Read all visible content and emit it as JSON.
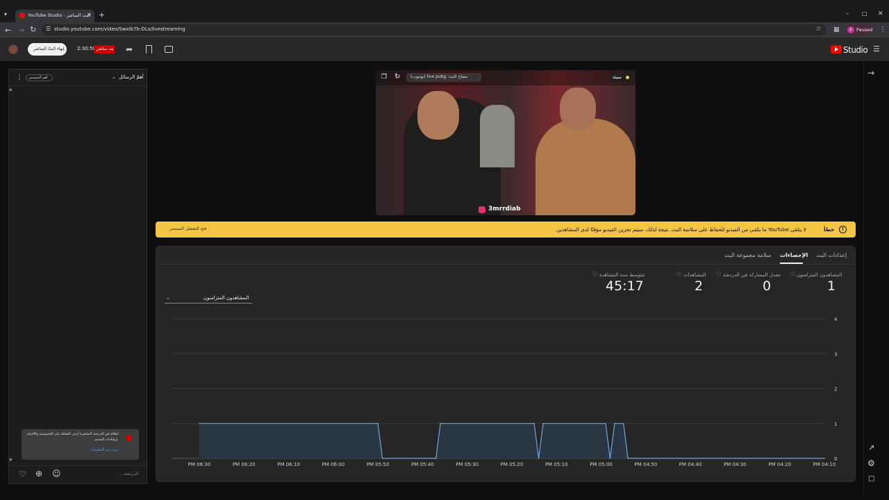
{
  "browser": {
    "tab_title": "YouTube Studio - البث المباشر",
    "url": "studio.youtube.com/video/Swxib7b-DLs/livestreaming",
    "profile_label": "Paused",
    "profile_initial": "s"
  },
  "header": {
    "logo_label": "Studio",
    "end_stream_label": "إنهاء البثّ المباشر",
    "timer": "2:30:58",
    "live_badge": "بث مباشر"
  },
  "chat": {
    "mode_label": "أهمّ الرسائل",
    "members_label": "أهم المنسيين",
    "notice_text_1": "اطلالة في الدردشة المباشرة أرجى الحفاظ على الخصوصية والالتزام",
    "notice_text_2": "بإرشادات المنتدى",
    "notice_link": "مزيد من المعلومات",
    "input_placeholder": "الدردشة..."
  },
  "video": {
    "status_label": "سيئة",
    "stream_key_label": "مفتاح البث:  live pubg (يوتيوب)",
    "watermark": "3mrrdiab"
  },
  "banner": {
    "error_prefix": "خطأ",
    "message": "لا يتلقى YouTube ما يكفي من الفيديو للحفاظ على سلاسة البث. نتيجة لذلك، سيتم تخزين الفيديو مؤقتًا لدى المشاهدين.",
    "action_label": "فتح التشغيل المستمر"
  },
  "analytics": {
    "tabs": [
      "إعدادات البث",
      "الإحصاءات",
      "سلامة مجموعة البث"
    ],
    "active_tab": "الإحصاءات",
    "metrics": [
      {
        "label": "المشاهدون المتزامنون",
        "value": "1"
      },
      {
        "label": "معدل المشاركة في الدردشة",
        "value": "0"
      },
      {
        "label": "المشاهدات",
        "value": "2"
      },
      {
        "label": "متوسط مدة المشاهدة",
        "value": "45:17"
      }
    ],
    "chart_selector": "المشاهدون المتزامنون"
  },
  "colors": {
    "accent": "#3ea6ff",
    "banner": "#f4c542",
    "live_red": "#cc0000",
    "area_fill": "#2a3644",
    "line": "#6fa8dc"
  },
  "chart_data": {
    "type": "area",
    "title": "",
    "xlabel": "",
    "ylabel": "",
    "ylim": [
      0,
      4
    ],
    "yticks": [
      "0",
      "1",
      "2",
      "3",
      "4"
    ],
    "x_ticks": [
      "PM 06:30",
      "PM 06:20",
      "PM 06:10",
      "PM 06:00",
      "PM 05:50",
      "PM 05:40",
      "PM 05:30",
      "PM 05:20",
      "PM 05:10",
      "PM 05:00",
      "PM 04:50",
      "PM 04:40",
      "PM 04:30",
      "PM 04:20",
      "PM 04:10"
    ],
    "x_note": "time runs right-to-left (RTL layout)",
    "series": [
      {
        "name": "المشاهدون المتزامنون",
        "points": [
          [
            "PM 06:30",
            1
          ],
          [
            "PM 05:50",
            1
          ],
          [
            "PM 05:49",
            0
          ],
          [
            "PM 05:37",
            0
          ],
          [
            "PM 05:36",
            1
          ],
          [
            "PM 05:15",
            1
          ],
          [
            "PM 05:14",
            0
          ],
          [
            "PM 05:13",
            1
          ],
          [
            "PM 04:59",
            1
          ],
          [
            "PM 04:58",
            0
          ],
          [
            "PM 04:57",
            1
          ],
          [
            "PM 04:55",
            1
          ],
          [
            "PM 04:54",
            0
          ],
          [
            "PM 04:10",
            0
          ]
        ]
      }
    ],
    "grid": true,
    "legend": "none"
  }
}
